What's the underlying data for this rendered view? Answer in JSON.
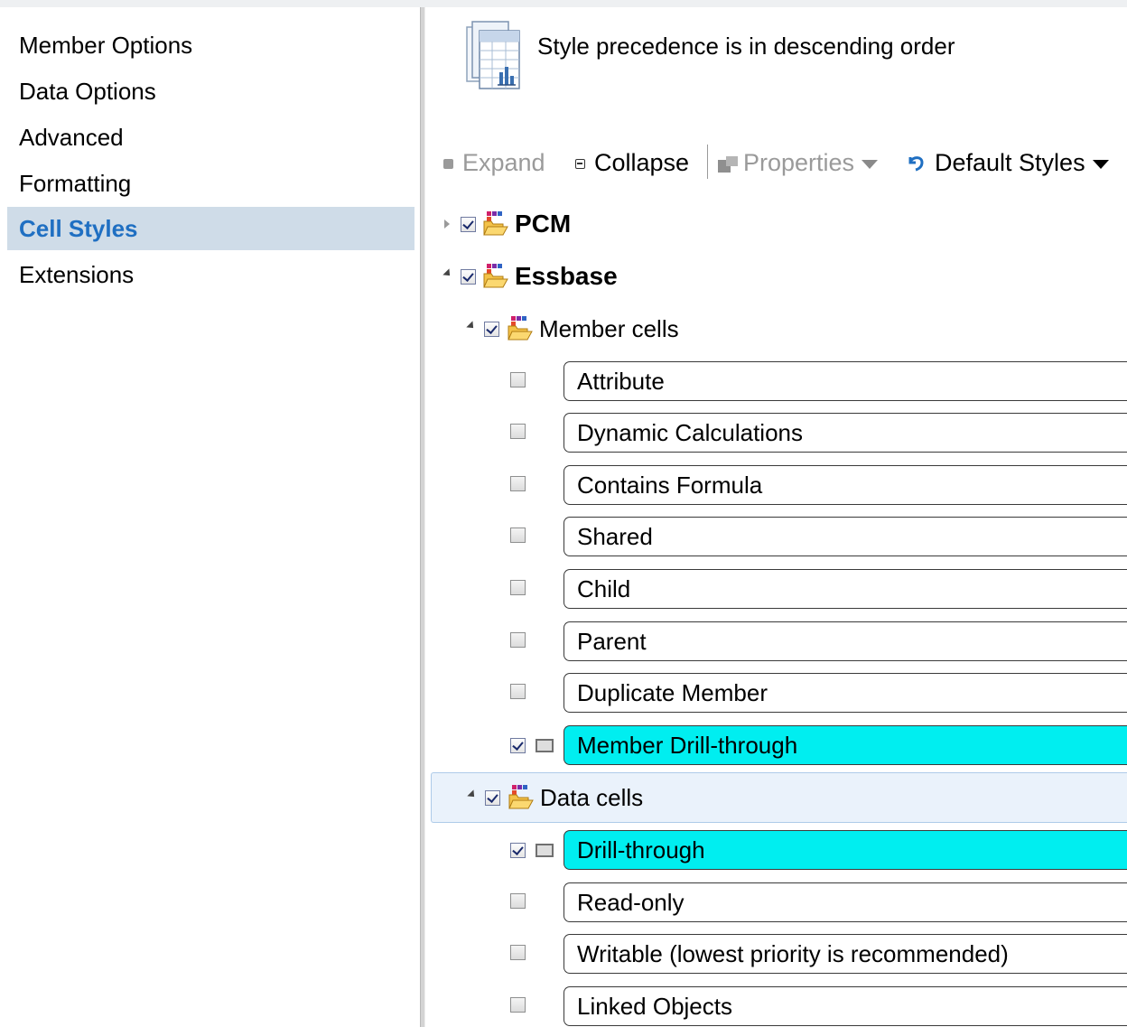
{
  "sidebar": {
    "items": [
      {
        "label": "Member Options"
      },
      {
        "label": "Data Options"
      },
      {
        "label": "Advanced"
      },
      {
        "label": "Formatting"
      },
      {
        "label": "Cell Styles",
        "selected": true
      },
      {
        "label": "Extensions"
      }
    ]
  },
  "header": {
    "text": "Style precedence is in descending order"
  },
  "toolbar": {
    "expand": "Expand",
    "collapse": "Collapse",
    "properties": "Properties",
    "default_styles": "Default Styles"
  },
  "tree": {
    "pcm": {
      "label": "PCM",
      "checked": true,
      "expanded": false
    },
    "essbase": {
      "label": "Essbase",
      "checked": true,
      "expanded": true
    },
    "member_cells": {
      "label": "Member cells",
      "checked": true,
      "expanded": true,
      "items": [
        {
          "label": "Attribute",
          "checked": false
        },
        {
          "label": "Dynamic Calculations",
          "checked": false
        },
        {
          "label": "Contains Formula",
          "checked": false
        },
        {
          "label": "Shared",
          "checked": false
        },
        {
          "label": "Child",
          "checked": false
        },
        {
          "label": "Parent",
          "checked": false
        },
        {
          "label": "Duplicate Member",
          "checked": false
        },
        {
          "label": "Member Drill-through",
          "checked": true,
          "color": "#00eef0"
        }
      ]
    },
    "data_cells": {
      "label": "Data cells",
      "checked": true,
      "expanded": true,
      "selected": true,
      "items": [
        {
          "label": "Drill-through",
          "checked": true,
          "color": "#00eef0"
        },
        {
          "label": "Read-only",
          "checked": false
        },
        {
          "label": "Writable (lowest priority is recommended)",
          "checked": false
        },
        {
          "label": "Linked Objects",
          "checked": false
        }
      ]
    }
  },
  "colors": {
    "selection_bg": "#cfdce8",
    "selection_text": "#1f6fc2",
    "highlight": "#00eef0"
  }
}
